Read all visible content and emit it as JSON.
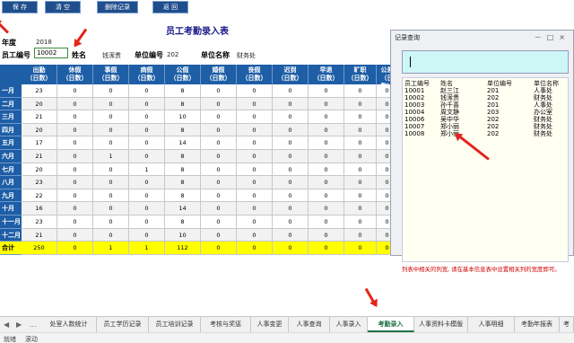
{
  "toolbar": {
    "save": "保 存",
    "clear": "清 空",
    "delete": "删除记录",
    "back": "返 回"
  },
  "form": {
    "title": "员工考勤录入表",
    "year_label": "年度",
    "year_value": "2018",
    "id_label": "员工编号",
    "id_value": "10002",
    "name_label": "姓名",
    "name_value": "钱潆贵",
    "unit_no_label": "单位编号",
    "unit_no_value": "202",
    "unit_name_label": "单位名称",
    "unit_name_value": "财务处"
  },
  "table": {
    "headers": [
      [
        "出勤",
        "（日数）"
      ],
      [
        "休假",
        "（日数）"
      ],
      [
        "事假",
        "（日数）"
      ],
      [
        "病假",
        "（日数）"
      ],
      [
        "公假",
        "（日数）"
      ],
      [
        "婚假",
        "（日数）"
      ],
      [
        "丧假",
        "（日数）"
      ],
      [
        "迟到",
        "（日数）"
      ],
      [
        "早退",
        "（日数）"
      ],
      [
        "旷职",
        "（日数）"
      ],
      [
        "公差",
        "（日数）"
      ]
    ],
    "rows": [
      {
        "month": "一月",
        "cells": [
          "23",
          "0",
          "0",
          "0",
          "8",
          "0",
          "0",
          "0",
          "0",
          "0",
          "0"
        ]
      },
      {
        "month": "二月",
        "cells": [
          "20",
          "0",
          "0",
          "0",
          "8",
          "0",
          "0",
          "0",
          "0",
          "0",
          "0"
        ]
      },
      {
        "month": "三月",
        "cells": [
          "21",
          "0",
          "0",
          "0",
          "10",
          "0",
          "0",
          "0",
          "0",
          "0",
          "0"
        ]
      },
      {
        "month": "四月",
        "cells": [
          "20",
          "0",
          "0",
          "0",
          "8",
          "0",
          "0",
          "0",
          "0",
          "0",
          "0"
        ]
      },
      {
        "month": "五月",
        "cells": [
          "17",
          "0",
          "0",
          "0",
          "14",
          "0",
          "0",
          "0",
          "0",
          "0",
          "0"
        ]
      },
      {
        "month": "六月",
        "cells": [
          "21",
          "0",
          "1",
          "0",
          "8",
          "0",
          "0",
          "0",
          "0",
          "0",
          "0"
        ]
      },
      {
        "month": "七月",
        "cells": [
          "20",
          "0",
          "0",
          "1",
          "8",
          "0",
          "0",
          "0",
          "0",
          "0",
          "0"
        ]
      },
      {
        "month": "八月",
        "cells": [
          "23",
          "0",
          "0",
          "0",
          "8",
          "0",
          "0",
          "0",
          "0",
          "0",
          "0"
        ]
      },
      {
        "month": "九月",
        "cells": [
          "22",
          "0",
          "0",
          "0",
          "8",
          "0",
          "0",
          "0",
          "0",
          "0",
          "0"
        ]
      },
      {
        "month": "十月",
        "cells": [
          "16",
          "0",
          "0",
          "0",
          "14",
          "0",
          "0",
          "0",
          "0",
          "0",
          "0"
        ]
      },
      {
        "month": "十一月",
        "cells": [
          "23",
          "0",
          "0",
          "0",
          "8",
          "0",
          "0",
          "0",
          "0",
          "0",
          "0"
        ]
      },
      {
        "month": "十二月",
        "cells": [
          "21",
          "0",
          "0",
          "0",
          "10",
          "0",
          "0",
          "0",
          "0",
          "0",
          "0"
        ]
      }
    ],
    "total": {
      "month": "合计",
      "cells": [
        "250",
        "0",
        "1",
        "1",
        "112",
        "0",
        "0",
        "0",
        "0",
        "0",
        "0"
      ]
    }
  },
  "dialog": {
    "title": "记录查询",
    "window_buttons": "－□×",
    "list_headers": [
      "员工编号",
      "姓名",
      "单位编号",
      "单位名称"
    ],
    "list_rows": [
      [
        "10001",
        "赵三江",
        "201",
        "人事处"
      ],
      [
        "10002",
        "钱潆贵",
        "202",
        "财务处"
      ],
      [
        "10003",
        "孙千喜",
        "201",
        "人事处"
      ],
      [
        "10004",
        "周文静",
        "203",
        "办公室"
      ],
      [
        "10006",
        "吴中华",
        "202",
        "财务处"
      ],
      [
        "10007",
        "郑小丽",
        "202",
        "财务处"
      ],
      [
        "10008",
        "郑小丽",
        "202",
        "财务处"
      ]
    ],
    "note": "列表中相关的列宽, 请在基本信息表中设置相关列的宽度即可。"
  },
  "sheet_tabs": {
    "nav_prev": "◀",
    "nav_next": "▶",
    "more": "...",
    "tabs": [
      "处室人数统计",
      "员工学历记录",
      "员工培训记录",
      "考核与奖惩",
      "人事变更",
      "人事查询",
      "人事录入",
      "考勤录入",
      "人事资料卡模版",
      "人事明细",
      "考勤年报表",
      "考"
    ],
    "active_index": 7
  },
  "status": {
    "ready": "就绪",
    "scroll": "滚动"
  },
  "colors": {
    "header_blue": "#1e5ea6",
    "total_yellow": "#ffff00",
    "arrow_red": "#e3241b",
    "active_tab_green": "#1e7145"
  }
}
